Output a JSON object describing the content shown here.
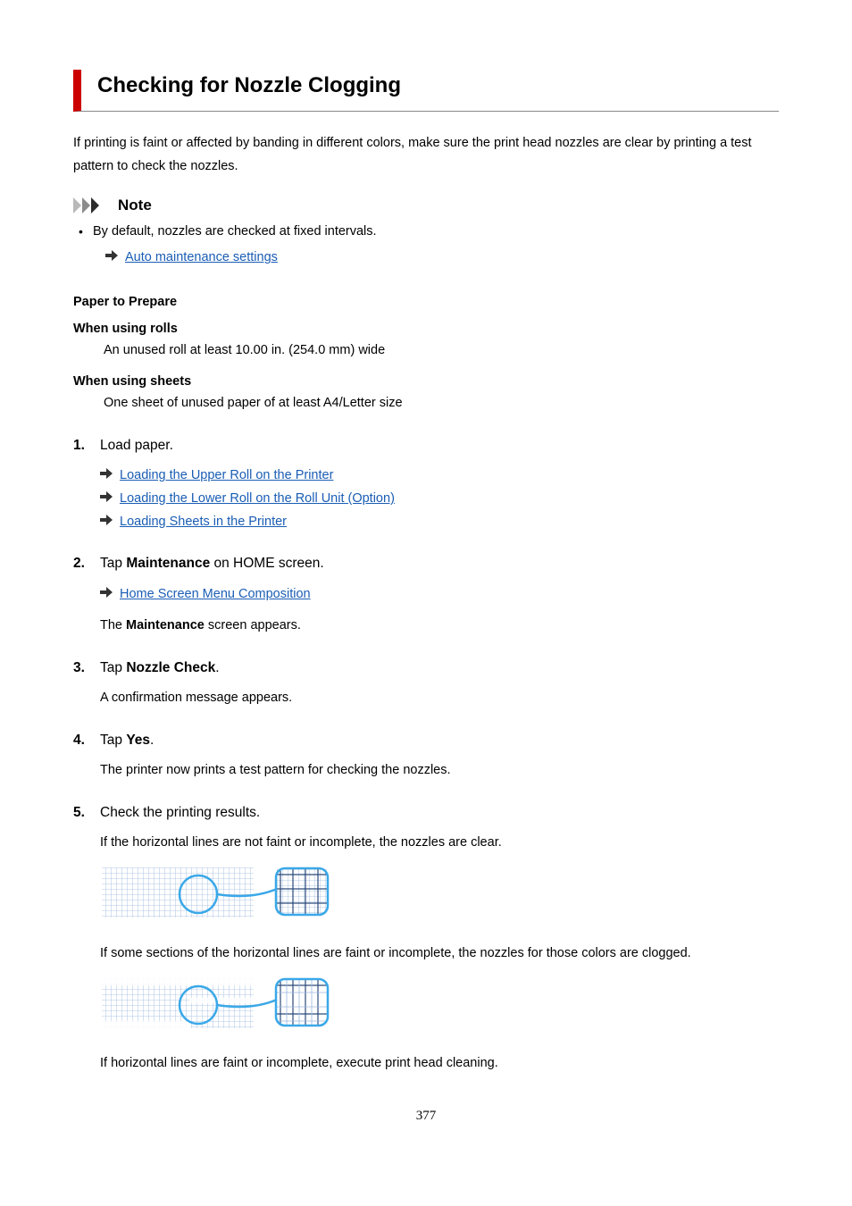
{
  "title": "Checking for Nozzle Clogging",
  "intro": "If printing is faint or affected by banding in different colors, make sure the print head nozzles are clear by printing a test pattern to check the nozzles.",
  "note_label": "Note",
  "note_bullet": "By default, nozzles are checked at fixed intervals.",
  "note_link": "Auto maintenance settings",
  "paper_header": "Paper to Prepare",
  "rolls_header": "When using rolls",
  "rolls_text": "An unused roll at least 10.00 in. (254.0 mm) wide",
  "sheets_header": "When using sheets",
  "sheets_text": "One sheet of unused paper of at least A4/Letter size",
  "steps": {
    "s1": {
      "head": "Load paper.",
      "links": [
        "Loading the Upper Roll on the Printer",
        "Loading the Lower Roll on the Roll Unit (Option)",
        "Loading Sheets in the Printer"
      ]
    },
    "s2": {
      "head_pre": "Tap ",
      "head_bold": "Maintenance",
      "head_post": " on HOME screen.",
      "link": "Home Screen Menu Composition",
      "result_pre": "The ",
      "result_bold": "Maintenance",
      "result_post": " screen appears."
    },
    "s3": {
      "head_pre": "Tap ",
      "head_bold": "Nozzle Check",
      "head_post": ".",
      "result": "A confirmation message appears."
    },
    "s4": {
      "head_pre": "Tap ",
      "head_bold": "Yes",
      "head_post": ".",
      "result": "The printer now prints a test pattern for checking the nozzles."
    },
    "s5": {
      "head": "Check the printing results.",
      "p1": "If the horizontal lines are not faint or incomplete, the nozzles are clear.",
      "p2": "If some sections of the horizontal lines are faint or incomplete, the nozzles for those colors are clogged.",
      "p3": "If horizontal lines are faint or incomplete, execute print head cleaning."
    }
  },
  "page_number": "377"
}
